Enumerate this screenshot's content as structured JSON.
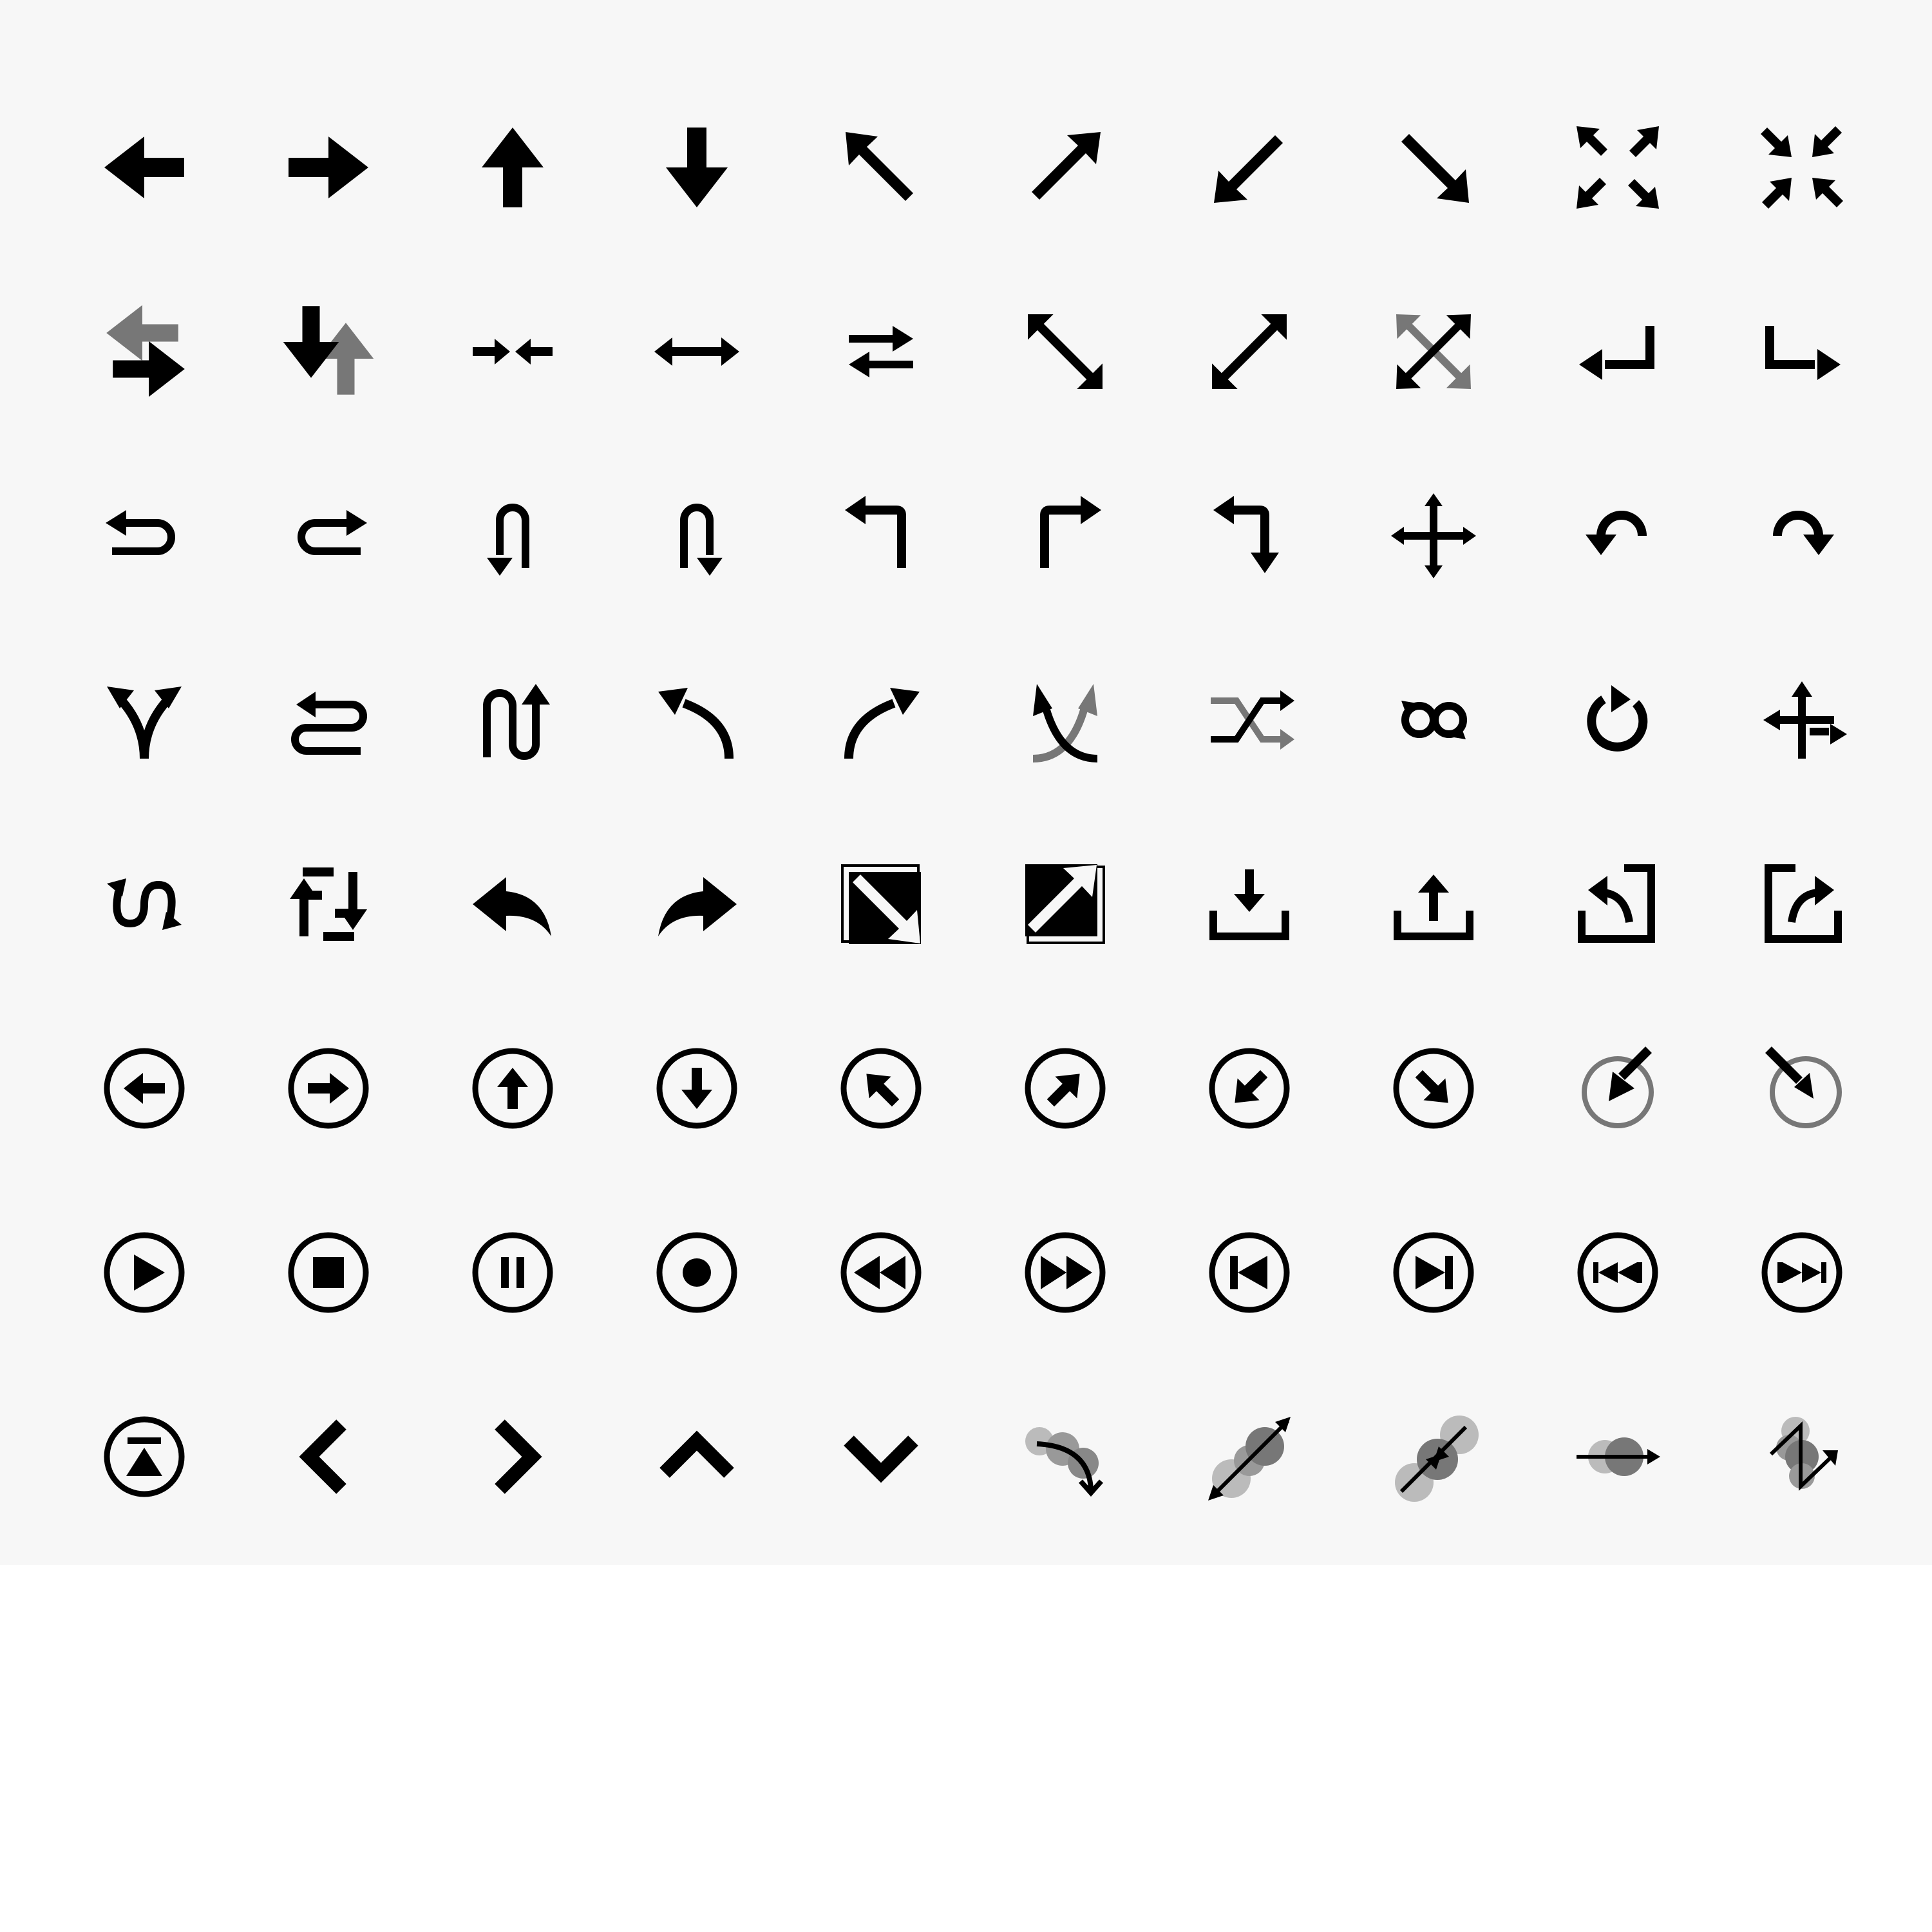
{
  "sheet": {
    "background": "#f7f7f7"
  },
  "colors": {
    "ink": "#000000",
    "secondary": "#777777",
    "muted": "#999999",
    "light": "#bbbbbb"
  },
  "rows": [
    [
      "arrow-left",
      "arrow-right",
      "arrow-up",
      "arrow-down",
      "arrow-up-left",
      "arrow-up-right",
      "arrow-down-left",
      "arrow-down-right",
      "expand",
      "collapse"
    ],
    [
      "swap-horizontal",
      "swap-vertical",
      "merge-horizontal",
      "arrow-left-right",
      "exchange",
      "arrow-diagonal-ne-sw",
      "arrow-diagonal-nw-se",
      "cross-diagonal",
      "return-left",
      "return-right"
    ],
    [
      "u-turn-left",
      "u-turn-right",
      "u-turn-down-left",
      "u-turn-down-right",
      "corner-up-left",
      "corner-up-right",
      "corner-left-down",
      "move",
      "undo",
      "redo"
    ],
    [
      "split",
      "zigzag-left",
      "zigzag-up",
      "curve-up-left",
      "curve-up-right",
      "cross-curve",
      "shuffle",
      "loop",
      "refresh",
      "branch-move"
    ],
    [
      "s-curve",
      "retweet",
      "reply",
      "forward",
      "import-box",
      "export-box",
      "download-tray",
      "upload-tray",
      "box-reply",
      "box-share"
    ],
    [
      "circle-arrow-left",
      "circle-arrow-right",
      "circle-arrow-up",
      "circle-arrow-down",
      "circle-arrow-up-left",
      "circle-arrow-up-right",
      "circle-arrow-down-left",
      "circle-arrow-down-right",
      "arrow-into-circle",
      "arrow-out-of-circle"
    ],
    [
      "play",
      "stop",
      "pause",
      "record",
      "rewind",
      "fast-forward",
      "skip-previous",
      "skip-next",
      "previous",
      "next"
    ],
    [
      "eject",
      "chevron-left",
      "chevron-right",
      "chevron-up",
      "chevron-down",
      "motion-curve",
      "motion-diagonal-scale",
      "motion-diagonal-merge",
      "motion-horizontal",
      "motion-zigzag"
    ]
  ]
}
